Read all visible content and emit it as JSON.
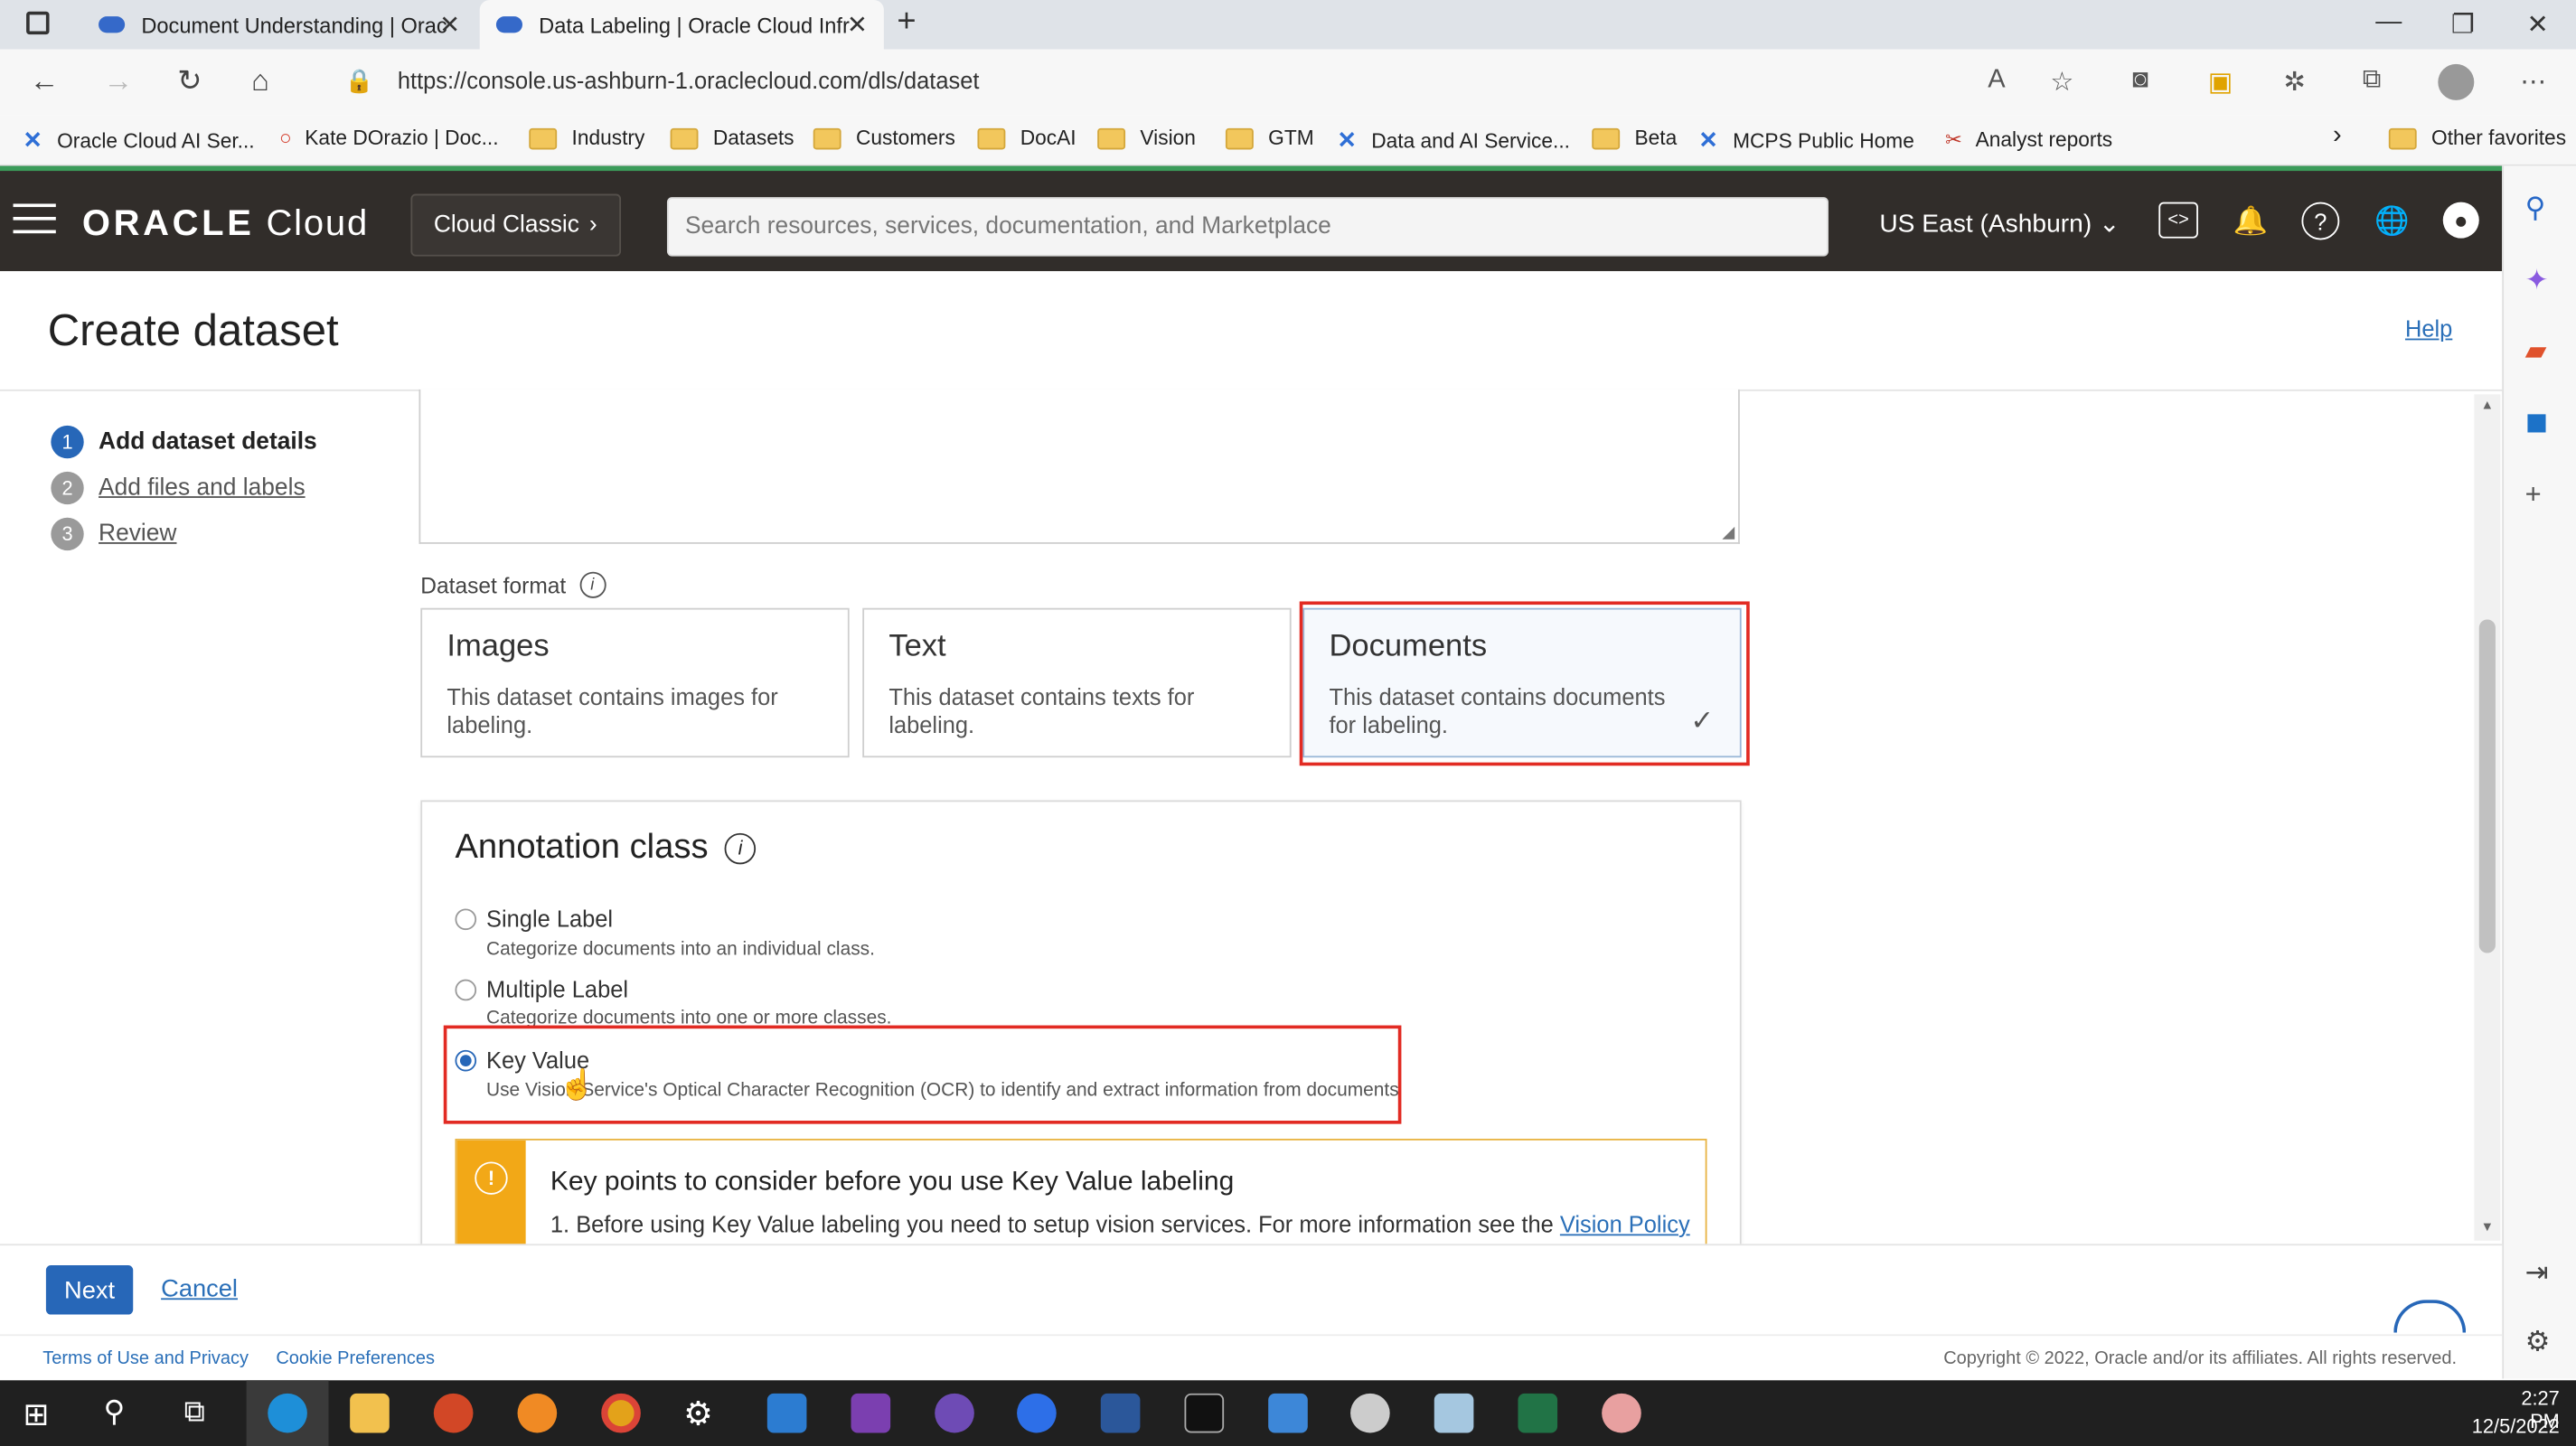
{
  "browser": {
    "tabs": [
      {
        "title": "Document Understanding | Orac",
        "active": false
      },
      {
        "title": "Data Labeling | Oracle Cloud Infr",
        "active": true
      }
    ],
    "url": "https://console.us-ashburn-1.oraclecloud.com/dls/dataset",
    "bookmarks": [
      {
        "label": "Oracle Cloud AI Ser...",
        "icon": "x-logo-icon"
      },
      {
        "label": "Kate DOrazio | Doc...",
        "icon": "oracle-o-icon"
      },
      {
        "label": "Industry",
        "icon": "folder-icon"
      },
      {
        "label": "Datasets",
        "icon": "folder-icon"
      },
      {
        "label": "Customers",
        "icon": "folder-icon"
      },
      {
        "label": "DocAI",
        "icon": "folder-icon"
      },
      {
        "label": "Vision",
        "icon": "folder-icon"
      },
      {
        "label": "GTM",
        "icon": "folder-icon"
      },
      {
        "label": "Data and AI Service...",
        "icon": "x-logo-icon"
      },
      {
        "label": "Beta",
        "icon": "folder-icon"
      },
      {
        "label": "MCPS Public Home",
        "icon": "x-logo-icon"
      },
      {
        "label": "Analyst reports",
        "icon": "tools-icon"
      }
    ],
    "other_favorites": "Other favorites"
  },
  "header": {
    "brand_bold": "ORACLE",
    "brand_light": "Cloud",
    "cloud_classic": "Cloud Classic",
    "search_placeholder": "Search resources, services, documentation, and Marketplace",
    "region": "US East (Ashburn)"
  },
  "page": {
    "title": "Create dataset",
    "help": "Help"
  },
  "steps": [
    {
      "num": "1",
      "label": "Add dataset details",
      "state": "current"
    },
    {
      "num": "2",
      "label": "Add files and labels",
      "state": "pending"
    },
    {
      "num": "3",
      "label": "Review",
      "state": "pending"
    }
  ],
  "dataset_format": {
    "label": "Dataset format",
    "options": [
      {
        "title": "Images",
        "desc": "This dataset contains images for labeling.",
        "selected": false
      },
      {
        "title": "Text",
        "desc": "This dataset contains texts for labeling.",
        "selected": false
      },
      {
        "title": "Documents",
        "desc": "This dataset contains documents for labeling.",
        "selected": true
      }
    ]
  },
  "annotation": {
    "title": "Annotation class",
    "options": [
      {
        "label": "Single Label",
        "desc": "Categorize documents into an individual class.",
        "selected": false
      },
      {
        "label": "Multiple Label",
        "desc": "Categorize documents into one or more classes.",
        "selected": false
      },
      {
        "label": "Key Value",
        "desc": "Use Vision Service's Optical Character Recognition (OCR) to identify and extract information from documents",
        "selected": true
      }
    ],
    "warning_title": "Key points to consider before you use Key Value labeling",
    "warning_text": "1. Before using Key Value labeling you need to setup vision services. For more information see the",
    "warning_link": "Vision Policy Quick Set Up documentation."
  },
  "footer": {
    "next": "Next",
    "cancel": "Cancel",
    "terms": "Terms of Use and Privacy",
    "cookies": "Cookie Preferences",
    "copyright": "Copyright © 2022, Oracle and/or its affiliates. All rights reserved."
  },
  "taskbar": {
    "time": "2:27 PM",
    "date": "12/5/2022"
  },
  "colors": {
    "oracle_header": "#312d2a",
    "primary_blue": "#2767b8",
    "highlight_red": "#e22b23",
    "warning_orange": "#f2a817"
  }
}
